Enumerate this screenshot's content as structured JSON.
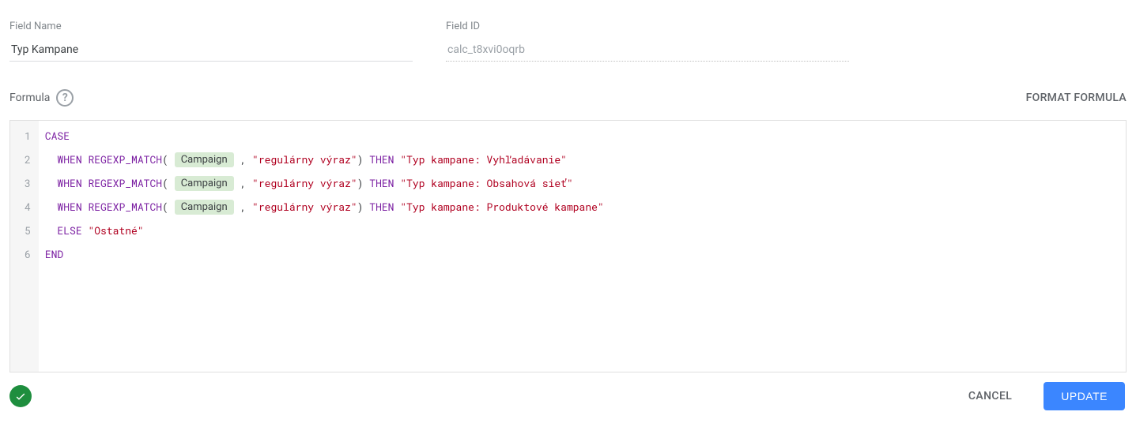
{
  "fields": {
    "name_label": "Field Name",
    "name_value": "Typ Kampane",
    "id_label": "Field ID",
    "id_value": "calc_t8xvi0oqrb"
  },
  "formula": {
    "label": "Formula",
    "format_btn": "FORMAT FORMULA",
    "chip_field": "Campaign",
    "regex_placeholder": "regulárny výraz",
    "lines": [
      {
        "n": 1,
        "kind": "case"
      },
      {
        "n": 2,
        "kind": "when",
        "then": "Typ kampane: Vyhľadávanie"
      },
      {
        "n": 3,
        "kind": "when",
        "then": "Typ kampane: Obsahová sieť"
      },
      {
        "n": 4,
        "kind": "when",
        "then": "Typ kampane: Produktové kampane"
      },
      {
        "n": 5,
        "kind": "else",
        "value": "Ostatné"
      },
      {
        "n": 6,
        "kind": "end"
      }
    ]
  },
  "footer": {
    "cancel": "CANCEL",
    "update": "UPDATE"
  }
}
